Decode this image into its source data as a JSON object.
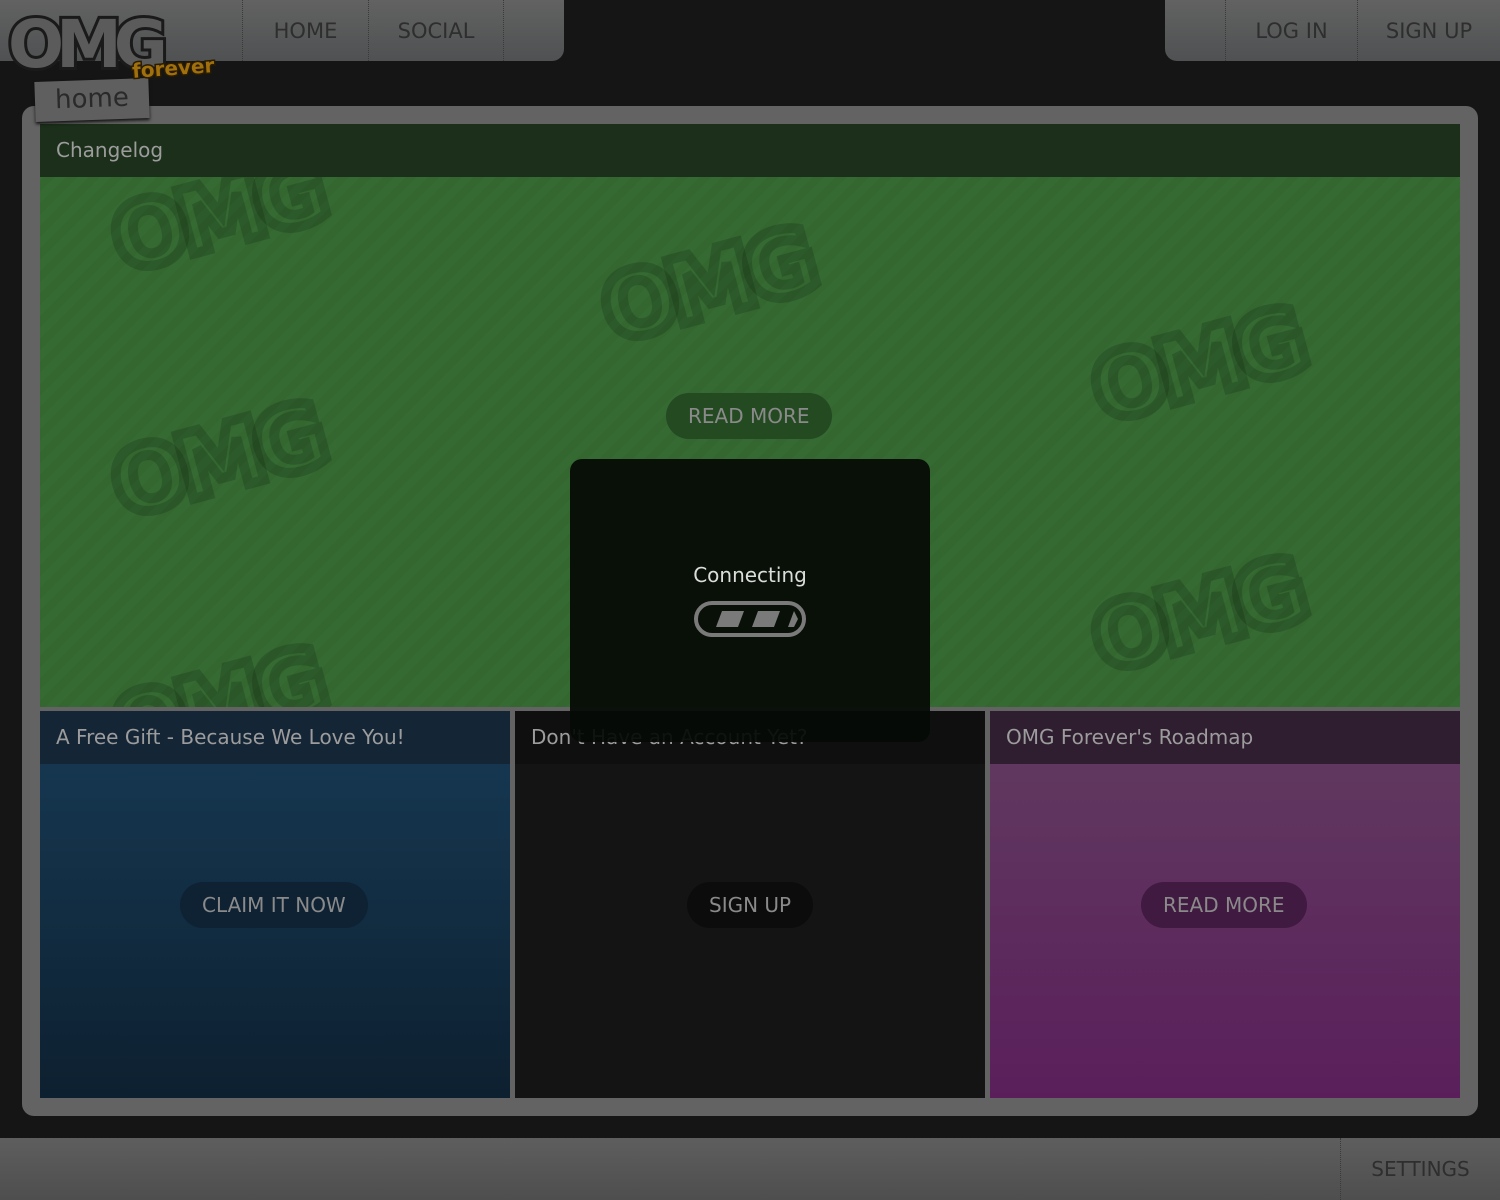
{
  "logo": {
    "text": "OMG",
    "sub": "forever",
    "tag": "home"
  },
  "nav": {
    "left": [
      "HOME",
      "SOCIAL"
    ],
    "right": [
      "LOG IN",
      "SIGN UP"
    ]
  },
  "panels": {
    "changelog": {
      "title": "Changelog",
      "button": "READ MORE",
      "color": "#356a33"
    },
    "gift": {
      "title": "A Free Gift - Because We Love You!",
      "button": "CLAIM IT NOW",
      "color": "#163a56"
    },
    "account": {
      "title": "Don't Have an Account Yet?",
      "button": "SIGN UP",
      "color": "#141414"
    },
    "roadmap": {
      "title": "OMG Forever's Roadmap",
      "button": "READ MORE",
      "color": "#5e2a5e"
    }
  },
  "modal": {
    "text": "Connecting",
    "icon": "loading-bar-icon"
  },
  "footer": {
    "settings": "SETTINGS"
  }
}
